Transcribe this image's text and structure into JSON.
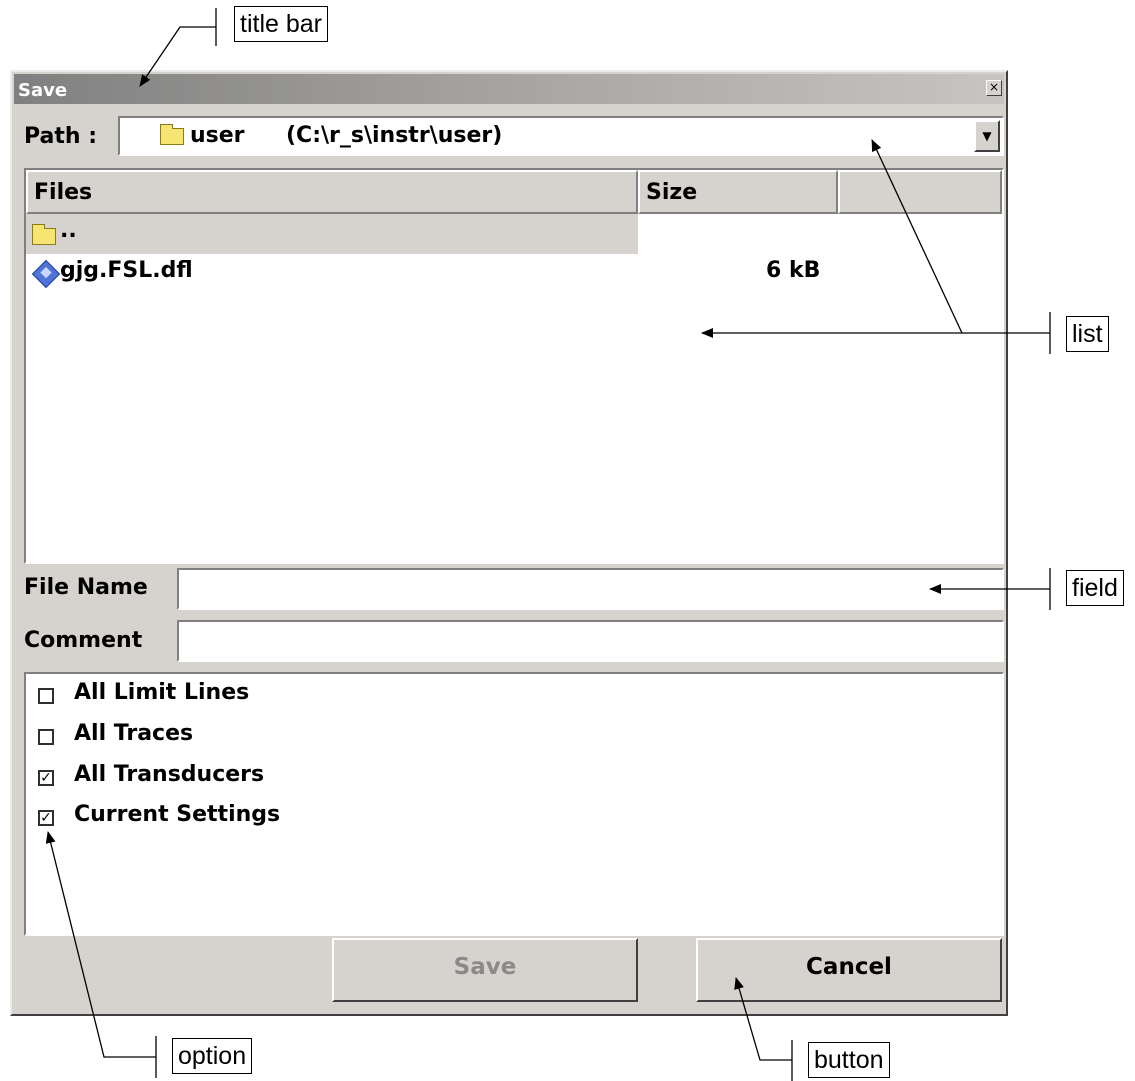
{
  "dialog": {
    "title": "Save",
    "close_glyph": "×",
    "path_label": "Path :",
    "path_value": "user",
    "path_detail": "(C:\\r_s\\instr\\user)",
    "dropdown_glyph": "▼",
    "list": {
      "columns": [
        "Files",
        "Size"
      ],
      "rows": [
        {
          "name": "..",
          "icon": "folder-icon",
          "size": ""
        },
        {
          "name": "gjg.FSL.dfl",
          "icon": "file-icon",
          "size": "6 kB"
        }
      ]
    },
    "file_name_label": "File Name",
    "file_name_value": "",
    "comment_label": "Comment",
    "comment_value": "",
    "options": [
      {
        "label": "All Limit Lines",
        "checked": false
      },
      {
        "label": "All Traces",
        "checked": false
      },
      {
        "label": "All Transducers",
        "checked": true
      },
      {
        "label": "Current Settings",
        "checked": true
      }
    ],
    "save_label": "Save",
    "cancel_label": "Cancel",
    "colors": {
      "face": "#d6d3ce",
      "title_gradient_start": "#808080",
      "disabled_text": "#8a8a8a"
    }
  },
  "annotations": {
    "title_bar": "title bar",
    "list": "list",
    "field": "field",
    "option": "option",
    "button": "button"
  }
}
